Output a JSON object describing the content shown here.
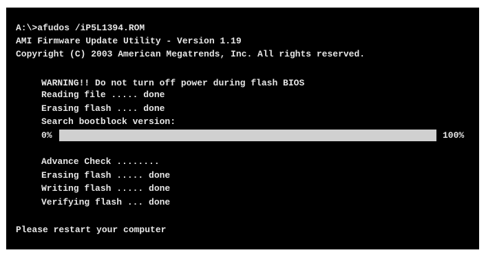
{
  "console": {
    "command": "A:\\>afudos /iP5L1394.ROM",
    "title": "AMI Firmware Update Utility - Version 1.19",
    "copyright": "Copyright (C) 2003 American Megatrends, Inc. All rights reserved.",
    "warning": "WARNING!! Do not turn off power during flash BIOS",
    "reading": "Reading file ..... done",
    "erasing1": "Erasing flash .... done",
    "search": "Search bootblock version:",
    "advance": "Advance Check ........",
    "erasing2": "Erasing flash ..... done",
    "writing": "Writing flash ..... done",
    "verifying": "Verifying flash ... done",
    "restart": "Please restart your computer"
  },
  "progress": {
    "start_label": "0%",
    "end_label": "100%",
    "value": 1.0
  },
  "colors": {
    "background": "#000000",
    "text": "#e6e6e6",
    "bar_fill": "#d0d0d0"
  }
}
